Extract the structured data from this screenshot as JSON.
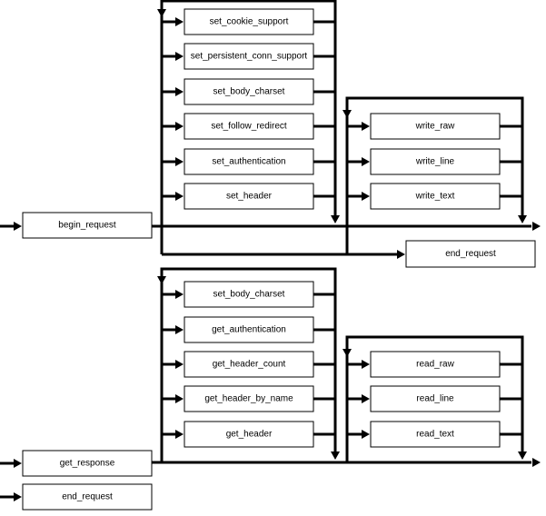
{
  "diagram": {
    "request_section": {
      "entry": "begin_request",
      "attribute_setters": [
        "set_cookie_support",
        "set_persistent_conn_support",
        "set_body_charset",
        "set_follow_redirect",
        "set_authentication",
        "set_header"
      ],
      "writers": [
        "write_raw",
        "write_line",
        "write_text"
      ],
      "exit": "end_request"
    },
    "response_section": {
      "entry": "get_response",
      "alt_entry": "end_request",
      "attribute_getters": [
        "set_body_charset",
        "get_authentication",
        "get_header_count",
        "get_header_by_name",
        "get_header"
      ],
      "readers": [
        "read_raw",
        "read_line",
        "read_text"
      ]
    },
    "colors": {
      "stroke": "#000000",
      "background": "#ffffff"
    }
  }
}
